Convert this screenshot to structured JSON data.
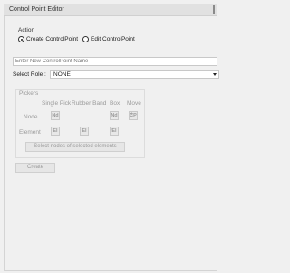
{
  "window": {
    "title": "Control Point Editor"
  },
  "action": {
    "label": "Action",
    "create_label": "Create ControlPoint",
    "edit_label": "Edit ControlPoint",
    "selected": "create"
  },
  "name_input": {
    "placeholder": "Enter New ControlPoint Name"
  },
  "role": {
    "label": "Select Role :",
    "value": "NONE"
  },
  "pickers": {
    "label": "Pickers",
    "columns": [
      "Single Pick",
      "Rubber Band",
      "Box",
      "Move"
    ],
    "rows": {
      "node_label": "Node",
      "element_label": "Element"
    },
    "buttons": {
      "node_single": "Nd",
      "node_box": "Nd",
      "node_move": "CP",
      "element_single": "El",
      "element_rubber": "El",
      "element_box": "El"
    },
    "select_nodes_label": "Select nodes of selected elements"
  },
  "create_label": "Create",
  "colors": {
    "background": "#f0f0f0",
    "disabled_text": "#9a9a9a",
    "border": "#c8c8c8"
  }
}
